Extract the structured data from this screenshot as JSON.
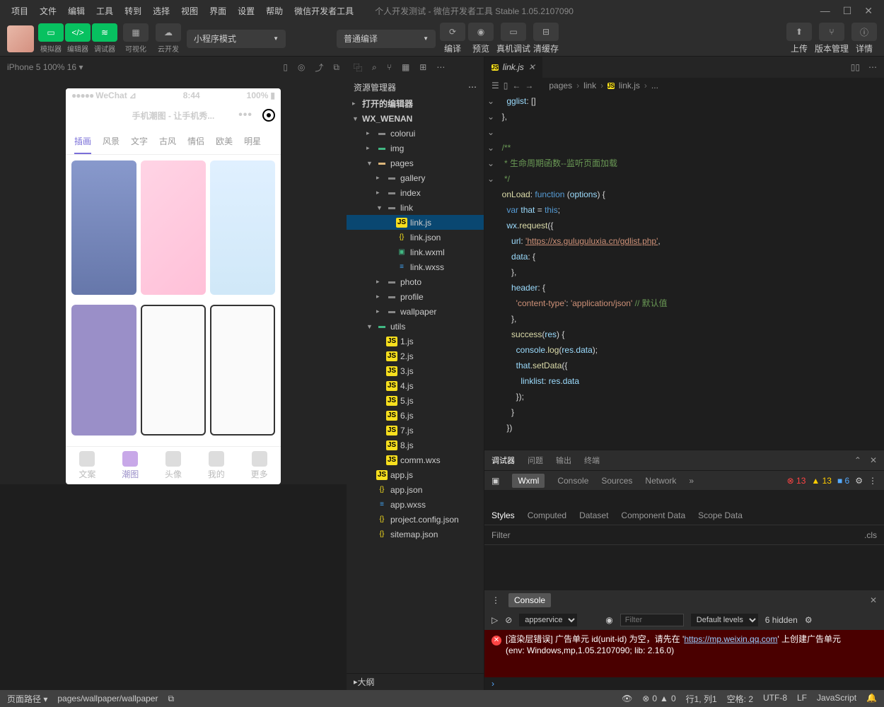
{
  "menubar": {
    "items": [
      "项目",
      "文件",
      "编辑",
      "工具",
      "转到",
      "选择",
      "视图",
      "界面",
      "设置",
      "帮助",
      "微信开发者工具"
    ],
    "title": "个人开发测试 - 微信开发者工具 Stable 1.05.2107090"
  },
  "topbar": {
    "labels": [
      "模拟器",
      "编辑器",
      "调试器",
      "可视化",
      "云开发"
    ],
    "mode": "小程序模式",
    "compile": "普通编译",
    "actions": [
      "编译",
      "预览",
      "真机调试",
      "清缓存"
    ],
    "right": [
      "上传",
      "版本管理",
      "详情"
    ]
  },
  "devicebar": {
    "device": "iPhone 5 100% 16",
    "arrow": "▾"
  },
  "phone": {
    "carrier": "WeChat",
    "signal": "●●●●●",
    "time": "8:44",
    "battery": "100%",
    "title": "手机潮图 - 让手机秀...",
    "tabs": [
      "插画",
      "风景",
      "文字",
      "古风",
      "情侣",
      "欧美",
      "明星"
    ],
    "nav": [
      "文案",
      "潮图",
      "头像",
      "我的",
      "更多"
    ]
  },
  "explorer": {
    "header": "资源管理器",
    "sections": [
      {
        "label": "打开的编辑器",
        "open": false
      },
      {
        "label": "WX_WENAN",
        "open": true
      }
    ],
    "tree": [
      {
        "d": 2,
        "t": "folder",
        "n": "colorui"
      },
      {
        "d": 2,
        "t": "folder",
        "n": "img",
        "c": "#41b883"
      },
      {
        "d": 2,
        "t": "folder",
        "n": "pages",
        "open": true,
        "c": "#dcb67a"
      },
      {
        "d": 3,
        "t": "folder",
        "n": "gallery"
      },
      {
        "d": 3,
        "t": "folder",
        "n": "index"
      },
      {
        "d": 3,
        "t": "folder",
        "n": "link",
        "open": true
      },
      {
        "d": 4,
        "t": "js",
        "n": "link.js",
        "sel": true
      },
      {
        "d": 4,
        "t": "json",
        "n": "link.json"
      },
      {
        "d": 4,
        "t": "wxml",
        "n": "link.wxml"
      },
      {
        "d": 4,
        "t": "wxss",
        "n": "link.wxss"
      },
      {
        "d": 3,
        "t": "folder",
        "n": "photo"
      },
      {
        "d": 3,
        "t": "folder",
        "n": "profile"
      },
      {
        "d": 3,
        "t": "folder",
        "n": "wallpaper"
      },
      {
        "d": 2,
        "t": "folder",
        "n": "utils",
        "open": true,
        "c": "#41b883"
      },
      {
        "d": 3,
        "t": "js",
        "n": "1.js"
      },
      {
        "d": 3,
        "t": "js",
        "n": "2.js"
      },
      {
        "d": 3,
        "t": "js",
        "n": "3.js"
      },
      {
        "d": 3,
        "t": "js",
        "n": "4.js"
      },
      {
        "d": 3,
        "t": "js",
        "n": "5.js"
      },
      {
        "d": 3,
        "t": "js",
        "n": "6.js"
      },
      {
        "d": 3,
        "t": "js",
        "n": "7.js"
      },
      {
        "d": 3,
        "t": "js",
        "n": "8.js"
      },
      {
        "d": 3,
        "t": "wxs",
        "n": "comm.wxs"
      },
      {
        "d": 2,
        "t": "js",
        "n": "app.js"
      },
      {
        "d": 2,
        "t": "json",
        "n": "app.json"
      },
      {
        "d": 2,
        "t": "wxss",
        "n": "app.wxss"
      },
      {
        "d": 2,
        "t": "json",
        "n": "project.config.json"
      },
      {
        "d": 2,
        "t": "json",
        "n": "sitemap.json"
      }
    ],
    "outline": "大纲"
  },
  "editor": {
    "tab": "link.js",
    "breadcrumb": [
      "pages",
      "link",
      "link.js",
      "..."
    ],
    "crumbicon": "JS"
  },
  "code": [
    {
      "html": "    <span class='prop'>gglist</span>: []"
    },
    {
      "html": "  },"
    },
    {
      "html": ""
    },
    {
      "html": "  <span class='cm'>/**</span>"
    },
    {
      "html": "  <span class='cm'> * 生命周期函数--监听页面加载</span>"
    },
    {
      "html": "  <span class='cm'> */</span>"
    },
    {
      "html": "  <span class='fn'>onLoad</span>: <span class='kw'>function</span> (<span class='prop'>options</span>) {"
    },
    {
      "html": "    <span class='kw'>var</span> <span class='prop'>that</span> = <span class='kw'>this</span>;"
    },
    {
      "html": "    <span class='prop'>wx</span>.<span class='fn'>request</span>({"
    },
    {
      "html": "      <span class='prop'>url</span>: <span class='str2'>'https://xs.guluguluxia.cn/gdlist.php'</span>,"
    },
    {
      "html": "      <span class='prop'>data</span>: {"
    },
    {
      "html": "      },"
    },
    {
      "html": "      <span class='prop'>header</span>: {"
    },
    {
      "html": "        <span class='str'>'content-type'</span>: <span class='str'>'application/json'</span> <span class='cm'>// 默认值</span>"
    },
    {
      "html": "      },"
    },
    {
      "html": "      <span class='fn'>success</span>(<span class='prop'>res</span>) {"
    },
    {
      "html": "        <span class='prop'>console</span>.<span class='fn'>log</span>(<span class='prop'>res</span>.<span class='prop'>data</span>);"
    },
    {
      "html": "        <span class='prop'>that</span>.<span class='fn'>setData</span>({"
    },
    {
      "html": "          <span class='prop'>linklist</span>: <span class='prop'>res</span>.<span class='prop'>data</span>"
    },
    {
      "html": "        });"
    },
    {
      "html": "      }"
    },
    {
      "html": "    })"
    }
  ],
  "debugger": {
    "tabs": [
      "调试器",
      "问题",
      "输出",
      "终端"
    ],
    "devtabs": [
      "Wxml",
      "Console",
      "Sources",
      "Network"
    ],
    "errors": "13",
    "warnings": "13",
    "info": "6",
    "styletabs": [
      "Styles",
      "Computed",
      "Dataset",
      "Component Data",
      "Scope Data"
    ],
    "filter": "Filter",
    "cls": ".cls"
  },
  "console": {
    "tab": "Console",
    "drop": "appservice",
    "filter_ph": "Filter",
    "levels": "Default levels",
    "hidden": "6 hidden",
    "err1": "[渲染层错误] 广告单元 id(unit-id) 为空，请先在 '",
    "errlink": "https://mp.weixin.qq.com",
    "err2": "' 上创建广告单元",
    "env": "(env: Windows,mp,1.05.2107090; lib: 2.16.0)"
  },
  "statusbar": {
    "path_label": "页面路径",
    "path": "pages/wallpaper/wallpaper",
    "w0": "0",
    "w1": "0",
    "pos": "行1, 列1",
    "spaces": "空格: 2",
    "enc": "UTF-8",
    "eol": "LF",
    "lang": "JavaScript"
  }
}
